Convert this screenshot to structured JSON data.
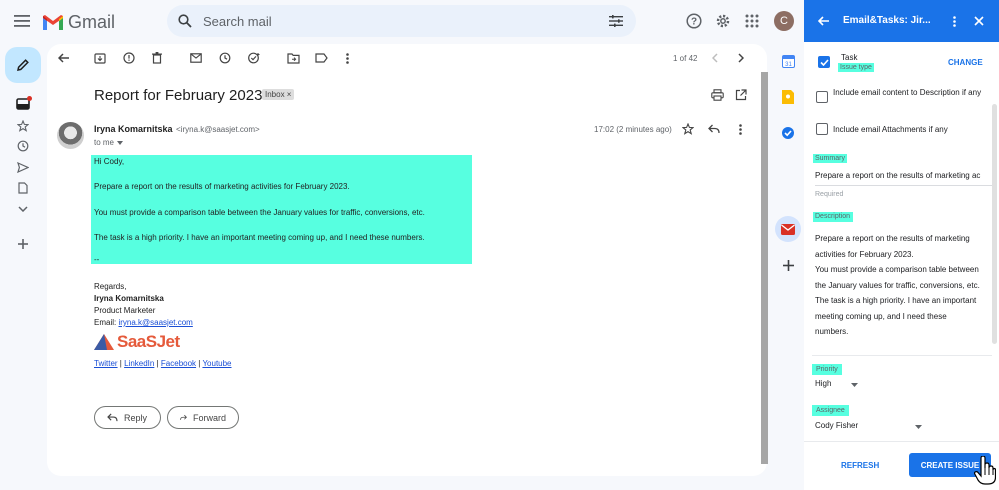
{
  "app": {
    "name": "Gmail"
  },
  "search": {
    "placeholder": "Search mail"
  },
  "account": {
    "avatar_letter": "C"
  },
  "toolbar": {
    "page_count": "1 of 42"
  },
  "mail": {
    "subject": "Report for February 2023",
    "label_chip": "Inbox ×",
    "sender_name": "Iryna Komarnitska",
    "sender_email": "<iryna.k@saasjet.com>",
    "to": "to me",
    "time": "17:02 (2 minutes ago)",
    "body": [
      "Hi Cody,",
      "Prepare a report on the results of marketing activities for February 2023.",
      "You must provide a comparison table between the January values for traffic, conversions, etc.",
      "The task is a high priority. I have an important meeting coming up, and I need these numbers.",
      "--"
    ],
    "signature": {
      "regards": "Regards,",
      "name": "Iryna Komarnitska",
      "title": "Product Marketer",
      "email_label": "Email:",
      "email": "iryna.k@saasjet.com",
      "brand": "SaaSJet",
      "links": [
        "Twitter",
        "LinkedIn",
        "Facebook",
        "Youtube"
      ],
      "separator": "|"
    },
    "reply_label": "Reply",
    "forward_label": "Forward"
  },
  "addon": {
    "title": "Email&Tasks: Jir...",
    "issue_type_value": "Task",
    "issue_type_label": "Issue type",
    "change_label": "CHANGE",
    "include_content": "Include email content to Description if any",
    "include_attachments": "Include email Attachments if any",
    "summary_label": "Summary",
    "summary_value": "Prepare a report on the results of marketing ac",
    "required_label": "Required",
    "description_label": "Description",
    "description_lines": [
      "Prepare a report on the results of marketing",
      "activities for February 2023.",
      "You must provide a comparison table between",
      "the January values for traffic, conversions, etc.",
      "The task is a high priority. I have an important",
      "meeting coming up, and I need these",
      "numbers."
    ],
    "priority_label": "Priority",
    "priority_value": "High",
    "assignee_label": "Assignee",
    "assignee_value": "Cody Fisher",
    "refresh_label": "REFRESH",
    "create_label": "CREATE ISSUE"
  },
  "colors": {
    "highlight": "#57ffe0",
    "addon_blue": "#1a73e8",
    "compose_bg": "#c2e7ff"
  }
}
